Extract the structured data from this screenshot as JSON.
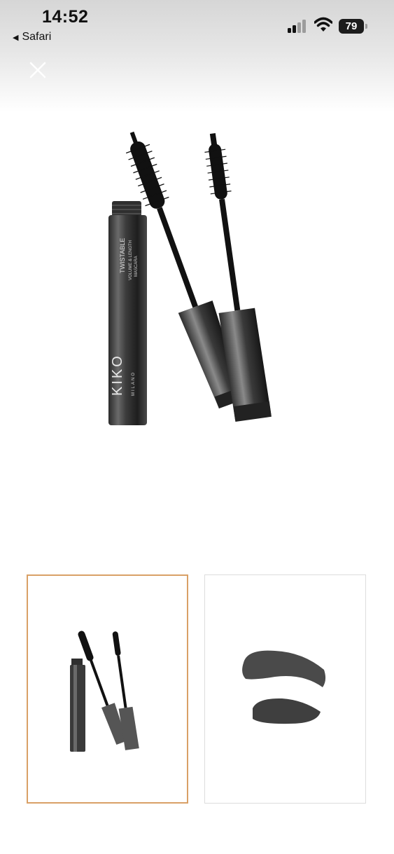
{
  "status_bar": {
    "time": "14:52",
    "back_label": "Safari",
    "battery_level": "79",
    "icons": [
      "cellular-signal-icon",
      "wifi-icon",
      "battery-icon"
    ]
  },
  "viewer": {
    "close_icon": "close-icon",
    "main_image": {
      "product_texts": [
        "TWISTABLE",
        "VOLUME & LENGTH",
        "MASCARA",
        "KIKO",
        "MILANO"
      ]
    },
    "thumbnails": [
      {
        "label": "product",
        "selected": true
      },
      {
        "label": "swatch",
        "selected": false
      }
    ],
    "accent_color": "#d9a066"
  }
}
